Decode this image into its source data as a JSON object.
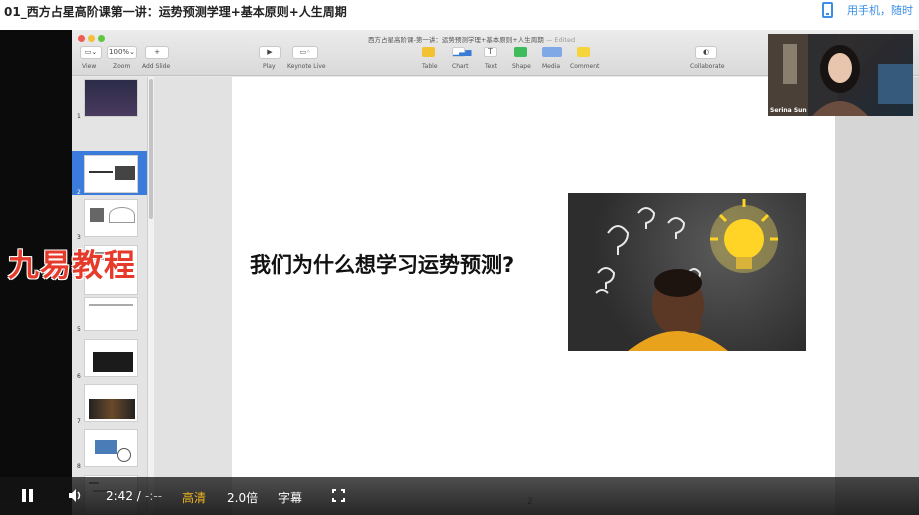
{
  "page": {
    "title": "01_西方占星高阶课第一讲：运势预测学理+基本原则+人生周期",
    "phone_link": "用手机，随时"
  },
  "keynote": {
    "window_title": "西方占星高阶课-第一讲：运势预测学理+基本原则+人生周期",
    "window_title_suffix": "— Edited",
    "zoom_value": "100%",
    "toolbar_labels": {
      "view": "View",
      "zoom": "Zoom",
      "add_slide": "Add Slide",
      "play": "Play",
      "keynote_live": "Keynote Live",
      "table": "Table",
      "chart": "Chart",
      "text": "Text",
      "shape": "Shape",
      "media": "Media",
      "comment": "Comment",
      "collaborate": "Collaborate"
    },
    "thumb_numbers": [
      "1",
      "2",
      "3",
      "5",
      "6",
      "7",
      "8"
    ],
    "slide": {
      "heading": "我们为什么想学习运势预测?",
      "number": "2"
    }
  },
  "webcam": {
    "name": "Serina Sun"
  },
  "watermark": "九易教程",
  "controls": {
    "time_current": "2:42 /",
    "time_total": "-:--",
    "quality": "高清",
    "speed": "2.0倍",
    "subtitles": "字幕"
  },
  "colors": {
    "accent_blue": "#3a8ee6",
    "quality_yellow": "#f2b51f",
    "watermark_red": "#e63a2b",
    "selection_blue": "#3b7bdc"
  }
}
